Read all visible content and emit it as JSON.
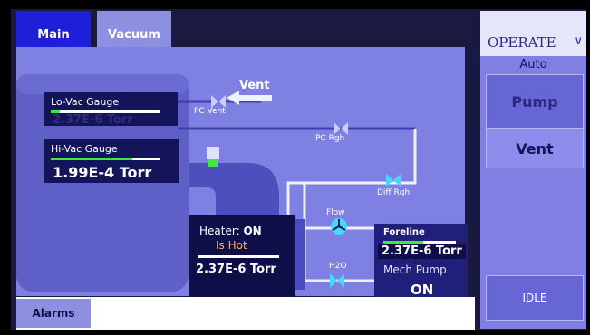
{
  "tabs": {
    "main": "Main",
    "vacuum": "Vacuum"
  },
  "lo_vac": {
    "label": "Lo-Vac Gauge",
    "value": "2.37E-6 Torr",
    "level": 0.08
  },
  "hi_vac": {
    "label": "Hi-Vac Gauge",
    "value": "1.99E-4 Torr",
    "level": 0.75
  },
  "valves": {
    "vent_arrow": "Vent",
    "pc_vent": "PC Vent",
    "pc_rgh": "PC Rgh",
    "diff_rgh": "Diff Rgh",
    "flow": "Flow",
    "h2o": "H2O"
  },
  "heater": {
    "label": "Heater:",
    "state": "ON",
    "status": "Is Hot",
    "pressure": "2.37E-6 Torr",
    "level": 0.35
  },
  "foreline": {
    "label": "Foreline",
    "value": "2.37E-6 Torr",
    "mech_pump_label": "Mech Pump",
    "mech_pump_state": "ON",
    "level": 0.55
  },
  "side": {
    "operate": "OPERATE",
    "mode": "Auto",
    "pump": "Pump",
    "vent": "Vent",
    "status": "IDLE"
  },
  "alarms": "Alarms",
  "colors": {
    "panel": "#7e80e2",
    "gauge_bg": "#14145a",
    "tab_active": "#1f1ed8",
    "valve": "#47d8ff",
    "hot": "#ffb060"
  },
  "icons": {
    "valve": "butterfly-valve-icon",
    "flow": "fan-icon",
    "heater": "heater-coil-icon",
    "arrow": "arrow-left-icon"
  }
}
